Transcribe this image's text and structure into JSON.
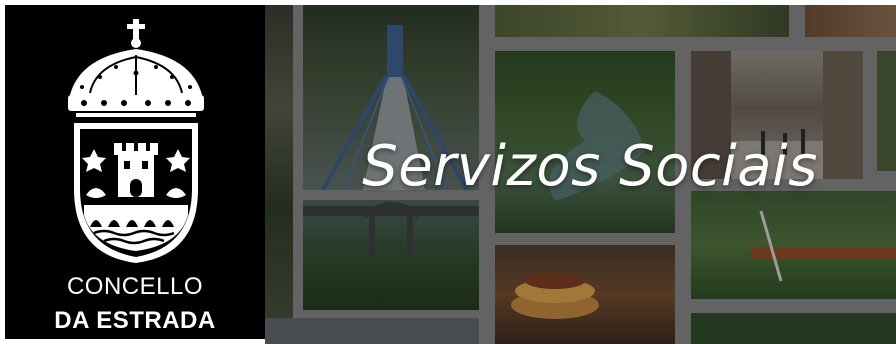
{
  "municipality": {
    "line1": "CONCELLO",
    "line2": "DA ESTRADA"
  },
  "banner": {
    "title": "Servizos Sociais"
  },
  "colors": {
    "logo_background": "#000000",
    "title": "#ffffff",
    "collage_frame": "#7f7f7f"
  }
}
